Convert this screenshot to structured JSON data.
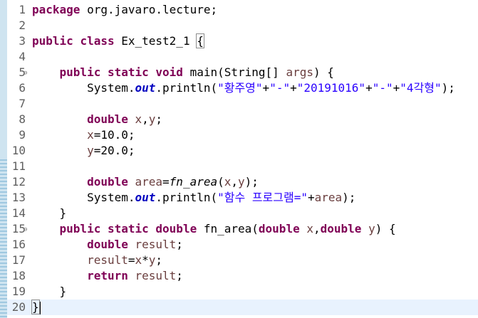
{
  "editor": {
    "lines": [
      {
        "n": "1",
        "c": [
          {
            "t": "package",
            "s": "kw"
          },
          {
            "t": " org.javaro.lecture;"
          }
        ]
      },
      {
        "n": "2",
        "c": []
      },
      {
        "n": "3",
        "c": [
          {
            "t": "public",
            "s": "kw"
          },
          {
            "t": " "
          },
          {
            "t": "class",
            "s": "kw"
          },
          {
            "t": " Ex_test2_1 "
          },
          {
            "t": "{",
            "s": "brace-hl"
          }
        ]
      },
      {
        "n": "4",
        "c": []
      },
      {
        "n": "5",
        "fold": "⊖",
        "c": [
          {
            "t": "    "
          },
          {
            "t": "public",
            "s": "kw"
          },
          {
            "t": " "
          },
          {
            "t": "static",
            "s": "kw"
          },
          {
            "t": " "
          },
          {
            "t": "void",
            "s": "kw"
          },
          {
            "t": " main(String[] "
          },
          {
            "t": "args",
            "s": "loc"
          },
          {
            "t": ") {"
          }
        ]
      },
      {
        "n": "6",
        "c": [
          {
            "t": "        System."
          },
          {
            "t": "out",
            "s": "fld"
          },
          {
            "t": ".println("
          },
          {
            "t": "\"황주영\"",
            "s": "str"
          },
          {
            "t": "+"
          },
          {
            "t": "\"-\"",
            "s": "str"
          },
          {
            "t": "+"
          },
          {
            "t": "\"20191016\"",
            "s": "str"
          },
          {
            "t": "+"
          },
          {
            "t": "\"-\"",
            "s": "str"
          },
          {
            "t": "+"
          },
          {
            "t": "\"4각형\"",
            "s": "str"
          },
          {
            "t": ");"
          }
        ]
      },
      {
        "n": "7",
        "c": []
      },
      {
        "n": "8",
        "c": [
          {
            "t": "        "
          },
          {
            "t": "double",
            "s": "kw"
          },
          {
            "t": " "
          },
          {
            "t": "x",
            "s": "loc"
          },
          {
            "t": ","
          },
          {
            "t": "y",
            "s": "loc"
          },
          {
            "t": ";"
          }
        ]
      },
      {
        "n": "9",
        "c": [
          {
            "t": "        "
          },
          {
            "t": "x",
            "s": "loc"
          },
          {
            "t": "=10.0;"
          }
        ]
      },
      {
        "n": "10",
        "c": [
          {
            "t": "        "
          },
          {
            "t": "y",
            "s": "loc"
          },
          {
            "t": "=20.0;"
          }
        ]
      },
      {
        "n": "11",
        "c": []
      },
      {
        "n": "12",
        "c": [
          {
            "t": "        "
          },
          {
            "t": "double",
            "s": "kw"
          },
          {
            "t": " "
          },
          {
            "t": "area",
            "s": "loc"
          },
          {
            "t": "="
          },
          {
            "t": "fn_area",
            "s": "mcall"
          },
          {
            "t": "("
          },
          {
            "t": "x",
            "s": "loc"
          },
          {
            "t": ","
          },
          {
            "t": "y",
            "s": "loc"
          },
          {
            "t": ");"
          }
        ]
      },
      {
        "n": "13",
        "c": [
          {
            "t": "        System."
          },
          {
            "t": "out",
            "s": "fld"
          },
          {
            "t": ".println("
          },
          {
            "t": "\"함수 프로그램=\"",
            "s": "str"
          },
          {
            "t": "+"
          },
          {
            "t": "area",
            "s": "loc"
          },
          {
            "t": ");"
          }
        ]
      },
      {
        "n": "14",
        "c": [
          {
            "t": "    }"
          }
        ]
      },
      {
        "n": "15",
        "fold": "⊖",
        "c": [
          {
            "t": "    "
          },
          {
            "t": "public",
            "s": "kw"
          },
          {
            "t": " "
          },
          {
            "t": "static",
            "s": "kw"
          },
          {
            "t": " "
          },
          {
            "t": "double",
            "s": "kw"
          },
          {
            "t": " fn_area("
          },
          {
            "t": "double",
            "s": "kw"
          },
          {
            "t": " "
          },
          {
            "t": "x",
            "s": "loc"
          },
          {
            "t": ","
          },
          {
            "t": "double",
            "s": "kw"
          },
          {
            "t": " "
          },
          {
            "t": "y",
            "s": "loc"
          },
          {
            "t": ") {"
          }
        ]
      },
      {
        "n": "16",
        "c": [
          {
            "t": "        "
          },
          {
            "t": "double",
            "s": "kw"
          },
          {
            "t": " "
          },
          {
            "t": "result",
            "s": "loc"
          },
          {
            "t": ";"
          }
        ]
      },
      {
        "n": "17",
        "c": [
          {
            "t": "        "
          },
          {
            "t": "result",
            "s": "loc"
          },
          {
            "t": "="
          },
          {
            "t": "x",
            "s": "loc"
          },
          {
            "t": "*"
          },
          {
            "t": "y",
            "s": "loc"
          },
          {
            "t": ";"
          }
        ]
      },
      {
        "n": "18",
        "c": [
          {
            "t": "        "
          },
          {
            "t": "return",
            "s": "kw"
          },
          {
            "t": " "
          },
          {
            "t": "result",
            "s": "loc"
          },
          {
            "t": ";"
          }
        ]
      },
      {
        "n": "19",
        "c": [
          {
            "t": "    }"
          }
        ]
      },
      {
        "n": "20",
        "current": true,
        "caret": true,
        "c": [
          {
            "t": "}",
            "s": "brace-hl"
          }
        ]
      }
    ]
  },
  "colors": {
    "keyword": "#7f0055",
    "string": "#2a00ff",
    "static_field": "#0000c0",
    "local_variable": "#6a3e3e",
    "line_number": "#5f5f5f",
    "current_line": "#e8f2fe",
    "gutter_stripe": "#cfe4f0"
  }
}
